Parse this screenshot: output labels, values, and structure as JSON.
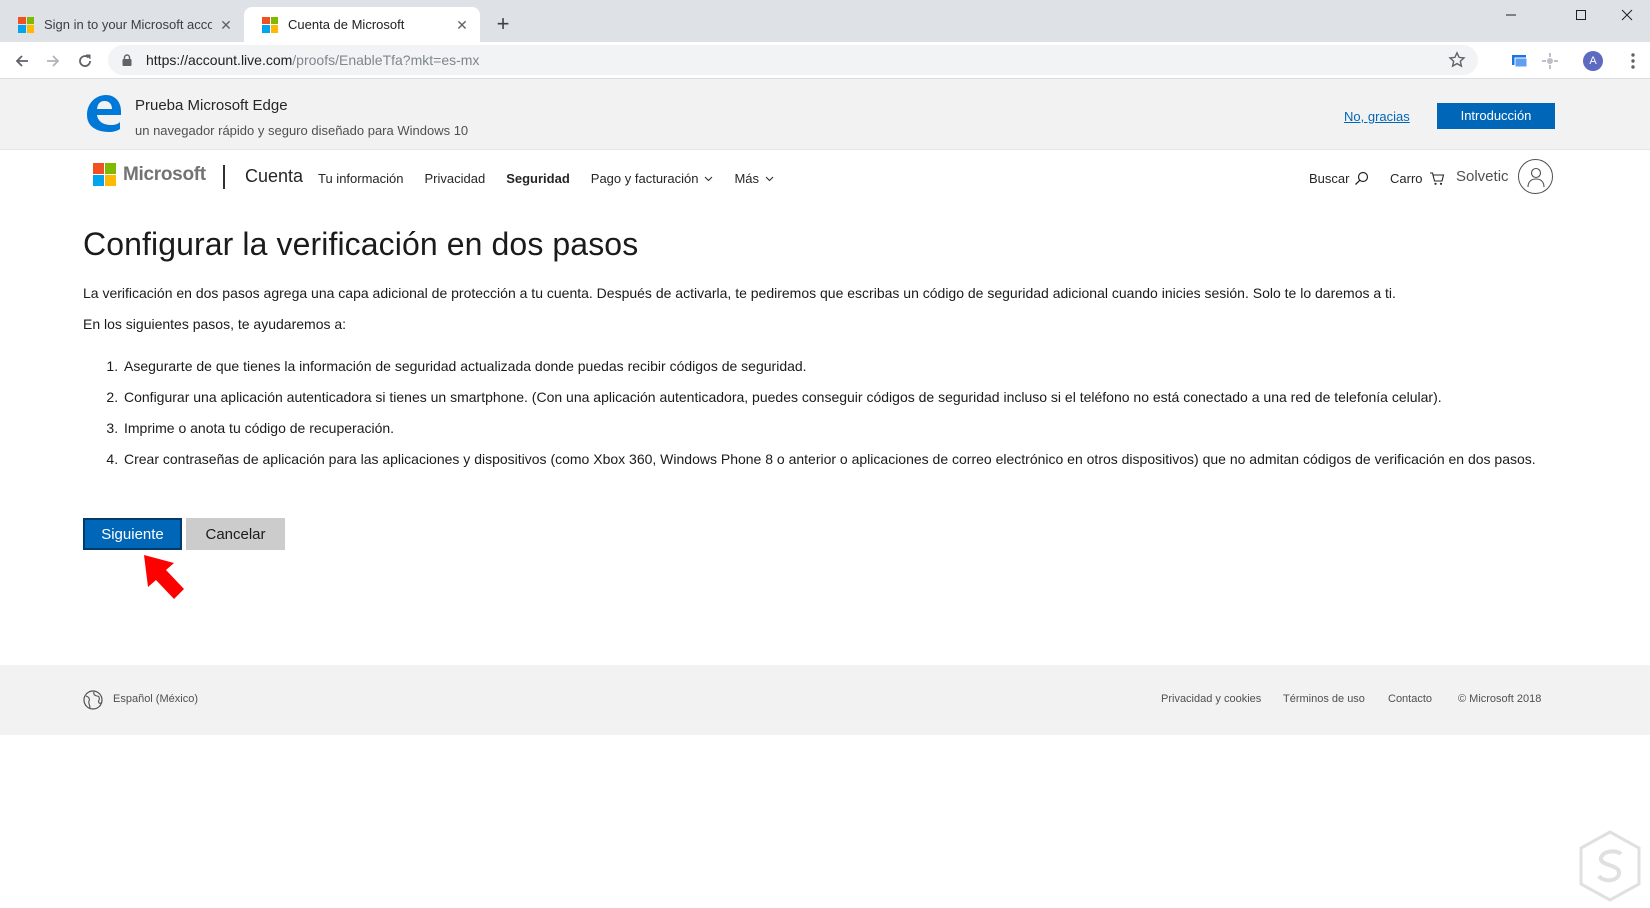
{
  "browser": {
    "tabs": [
      {
        "title": "Sign in to your Microsoft account",
        "active": false
      },
      {
        "title": "Cuenta de Microsoft",
        "active": true
      }
    ],
    "url_host": "https://account.live.com",
    "url_path": "/proofs/EnableTfa?mkt=es-mx",
    "profile_initial": "A"
  },
  "promo": {
    "title": "Prueba Microsoft Edge",
    "subtitle": "un navegador rápido y seguro diseñado para Windows 10",
    "no_thanks": "No, gracias",
    "cta": "Introducción"
  },
  "header": {
    "brand": "Microsoft",
    "section": "Cuenta",
    "nav": [
      {
        "label": "Tu información",
        "bold": false,
        "dropdown": false
      },
      {
        "label": "Privacidad",
        "bold": false,
        "dropdown": false
      },
      {
        "label": "Seguridad",
        "bold": true,
        "dropdown": false
      },
      {
        "label": "Pago y facturación",
        "bold": false,
        "dropdown": true
      },
      {
        "label": "Más",
        "bold": false,
        "dropdown": true
      }
    ],
    "search": "Buscar",
    "cart": "Carro",
    "user": "Solvetic"
  },
  "main": {
    "title": "Configurar la verificación en dos pasos",
    "intro": "La verificación en dos pasos agrega una capa adicional de protección a tu cuenta. Después de activarla, te pediremos que escribas un código de seguridad adicional cuando inicies sesión. Solo te lo daremos a ti.",
    "lead": "En los siguientes pasos, te ayudaremos a:",
    "steps": [
      "Asegurarte de que tienes la información de seguridad actualizada donde puedas recibir códigos de seguridad.",
      "Configurar una aplicación autenticadora si tienes un smartphone. (Con una aplicación autenticadora, puedes conseguir códigos de seguridad incluso si el teléfono no está conectado a una red de telefonía celular).",
      "Imprime o anota tu código de recuperación.",
      "Crear contraseñas de aplicación para las aplicaciones y dispositivos (como Xbox 360, Windows Phone 8 o anterior o aplicaciones de correo electrónico en otros dispositivos) que no admitan códigos de verificación en dos pasos."
    ],
    "next_label": "Siguiente",
    "cancel_label": "Cancelar"
  },
  "footer": {
    "locale": "Español (México)",
    "links": [
      "Privacidad y cookies",
      "Términos de uso",
      "Contacto"
    ],
    "copyright": "© Microsoft 2018"
  },
  "colors": {
    "ms_red": "#f25022",
    "ms_green": "#7fba00",
    "ms_blue": "#00a4ef",
    "ms_yellow": "#ffb900",
    "accent_blue": "#0067b8",
    "annotation_red": "#ff0000"
  },
  "icons": {
    "tab_favicon": "microsoft-logo-icon",
    "back": "back-arrow-icon",
    "forward": "forward-arrow-icon",
    "reload": "reload-icon",
    "lock": "lock-icon",
    "star": "bookmark-star-icon",
    "edge": "edge-logo-icon",
    "search": "search-icon",
    "cart": "cart-icon",
    "user": "user-icon",
    "globe": "globe-icon",
    "arrow": "red-pointer-arrow-icon"
  }
}
